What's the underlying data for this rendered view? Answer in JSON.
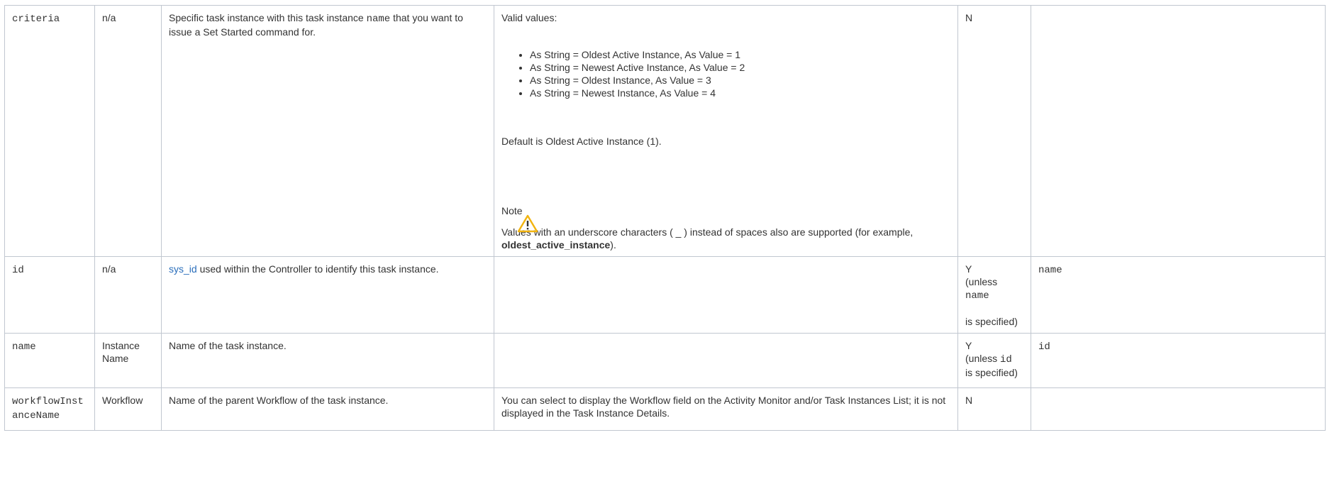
{
  "rows": [
    {
      "field": "criteria",
      "ui_field": "n/a",
      "description_pre": "Specific task instance with this task instance ",
      "description_code": "name",
      "description_post": " that you want to issue a Set Started command for.",
      "spec_intro": "Valid values:",
      "spec_values": [
        "As String = Oldest Active Instance, As Value = 1",
        "As String = Newest Active Instance, As Value = 2",
        "As String = Oldest Instance, As Value = 3",
        "As String = Newest Instance, As Value = 4"
      ],
      "spec_default": "Default is Oldest Active Instance (1).",
      "note_title": "Note",
      "note_body_pre": "Values with an underscore characters ( _ ) instead of spaces also are supported (for example, ",
      "note_body_bold": "oldest_active_instance",
      "note_body_post": ").",
      "required": "N",
      "mutually_exclusive": ""
    },
    {
      "field": "id",
      "ui_field": "n/a",
      "description_link": "sys_id",
      "description_post": " used within the Controller to identify this task instance.",
      "spec": "",
      "required_line1": "Y",
      "required_line2_pre": "(unless ",
      "required_line2_code": "name",
      "required_line3": "is specified)",
      "mutually_exclusive": "name"
    },
    {
      "field": "name",
      "ui_field": "Instance Name",
      "description": "Name of the task instance.",
      "spec": "",
      "required_line1": "Y",
      "required_line2_pre": "(unless ",
      "required_line2_code": "id",
      "required_line3": "is specified)",
      "mutually_exclusive": "id"
    },
    {
      "field": "workflowInstanceName",
      "ui_field": "Workflow",
      "description": "Name of the parent Workflow of the task instance.",
      "spec": "You can select to display the Workflow field on the Activity Monitor and/or Task Instances List; it is not displayed in the Task Instance Details.",
      "required": "N",
      "mutually_exclusive": ""
    }
  ],
  "colors": {
    "border": "#c1c7d0",
    "text": "#333333",
    "link": "#2a6ebb",
    "warning": "#f2b40f"
  },
  "icons": {
    "note": "warning-icon"
  }
}
